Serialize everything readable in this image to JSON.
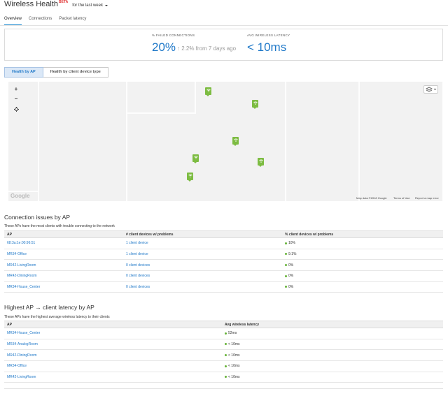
{
  "header": {
    "title": "Wireless Health",
    "beta": "BETA",
    "range_label": "for the last week"
  },
  "tabs": [
    {
      "label": "Overview",
      "active": true
    },
    {
      "label": "Connections",
      "active": false
    },
    {
      "label": "Packet latency",
      "active": false
    }
  ],
  "stats": {
    "failed": {
      "label": "% FAILED CONNECTIONS",
      "value": "20%",
      "delta": "↑ 2.2% from 7 days ago"
    },
    "latency": {
      "label": "AVG WIRELESS LATENCY",
      "value": "< 10ms"
    }
  },
  "segmented": {
    "by_ap": "Health by AP",
    "by_client": "Health by client device type"
  },
  "map": {
    "zoom_in": "+",
    "zoom_out": "−",
    "locate_icon": "crosshair-icon",
    "layers_icon": "layers-icon",
    "google": "Google",
    "attribution": {
      "data": "Map data ©2018 Google",
      "terms": "Terms of Use",
      "report": "Report a map error"
    },
    "pin_color": "#7dbc42"
  },
  "connection_issues": {
    "title": "Connection issues by AP",
    "description": "These APs have the most clients with trouble connecting to the network",
    "columns": [
      "AP",
      "# client devices w/ problems",
      "% client devices w/ problems"
    ],
    "rows": [
      {
        "ap": "68:3a:1e:00:96:51",
        "devices": "1 client device",
        "percent": "10%"
      },
      {
        "ap": "MR34-Office",
        "devices": "1 client device",
        "percent": "9.1%"
      },
      {
        "ap": "MR42-LivingRoom",
        "devices": "0 client devices",
        "percent": "0%"
      },
      {
        "ap": "MR42-DiningRoom",
        "devices": "0 client devices",
        "percent": "0%"
      },
      {
        "ap": "MR34-House_Center",
        "devices": "0 client devices",
        "percent": "0%"
      }
    ]
  },
  "latency": {
    "title": "Highest AP → client latency by AP",
    "description": "These APs have the highest average wireless latency to their clients",
    "columns": [
      "AP",
      "Avg wireless latency"
    ],
    "rows": [
      {
        "ap": "MR34-House_Center",
        "latency": "52ms"
      },
      {
        "ap": "MR34-AnalogRoom",
        "latency": "< 10ms"
      },
      {
        "ap": "MR42-DiningRoom",
        "latency": "< 10ms"
      },
      {
        "ap": "MR34-Office",
        "latency": "< 10ms"
      },
      {
        "ap": "MR42-LivingRoom",
        "latency": "< 10ms"
      }
    ]
  },
  "status_color": "#67b33a",
  "accent_color": "#1f78c8"
}
